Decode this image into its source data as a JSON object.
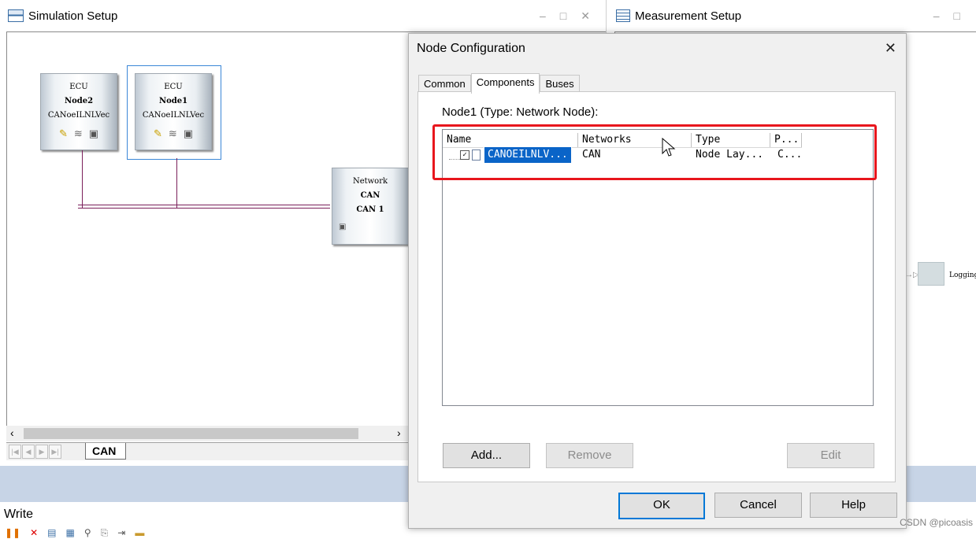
{
  "sim_window": {
    "title": "Simulation Setup",
    "controls": {
      "minimize": "–",
      "maximize": "□",
      "close": "✕"
    },
    "nodes": [
      {
        "type_label": "ECU",
        "name": "Node2",
        "module": "CANoeILNLVec"
      },
      {
        "type_label": "ECU",
        "name": "Node1",
        "module": "CANoeILNLVec"
      }
    ],
    "network": {
      "label": "Network",
      "bus": "CAN",
      "channel": "CAN 1"
    },
    "sheet_tab": "CAN"
  },
  "meas_window": {
    "title": "Measurement Setup",
    "controls": {
      "minimize": "–",
      "maximize": "□"
    },
    "logging_label": "Logging"
  },
  "write_panel": {
    "title": "Write"
  },
  "dialog": {
    "title": "Node Configuration",
    "tabs": [
      "Common",
      "Components",
      "Buses"
    ],
    "active_tab": "Components",
    "caption": "Node1 (Type: Network Node):",
    "columns": [
      "Name",
      "Networks",
      "Type",
      "P..."
    ],
    "rows": [
      {
        "name": "CANOEILNLV...",
        "networks": "CAN",
        "type": "Node Lay...",
        "p": "C...",
        "checked": true
      }
    ],
    "buttons": {
      "add": "Add...",
      "remove": "Remove",
      "edit": "Edit",
      "ok": "OK",
      "cancel": "Cancel",
      "help": "Help"
    }
  },
  "watermark": "CSDN @picoasis",
  "colors": {
    "highlight_box": "#e8161d",
    "selection": "#0a64c8",
    "bus_line": "#7a1f5a"
  }
}
